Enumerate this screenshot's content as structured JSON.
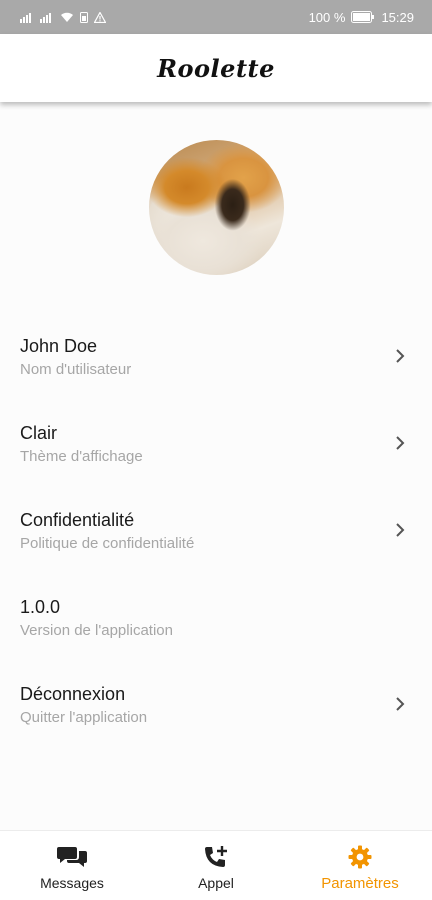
{
  "status_bar": {
    "battery": "100 %",
    "time": "15:29"
  },
  "header": {
    "app_title": "Roolette"
  },
  "settings": [
    {
      "title": "John Doe",
      "subtitle": "Nom d'utilisateur",
      "has_chevron": true
    },
    {
      "title": "Clair",
      "subtitle": "Thème d'affichage",
      "has_chevron": true
    },
    {
      "title": "Confidentialité",
      "subtitle": "Politique de confidentialité",
      "has_chevron": true
    },
    {
      "title": "1.0.0",
      "subtitle": "Version de l'application",
      "has_chevron": false
    },
    {
      "title": "Déconnexion",
      "subtitle": "Quitter l'application",
      "has_chevron": true
    }
  ],
  "bottom_nav": {
    "items": [
      {
        "label": "Messages",
        "icon": "chat-bubbles-icon",
        "active": false
      },
      {
        "label": "Appel",
        "icon": "phone-add-icon",
        "active": false
      },
      {
        "label": "Paramètres",
        "icon": "gear-icon",
        "active": true
      }
    ]
  },
  "colors": {
    "accent": "#f29400",
    "status_bar": "#a9a9a9",
    "subtitle": "#a6a6a6"
  }
}
